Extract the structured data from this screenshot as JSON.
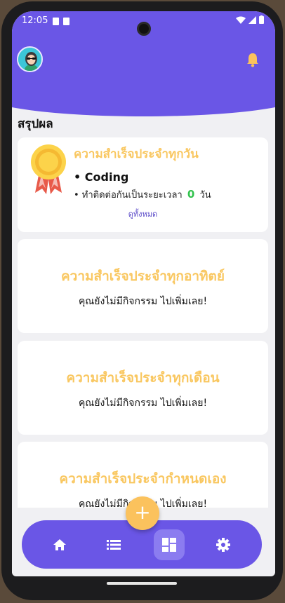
{
  "status_bar": {
    "time": "12:05"
  },
  "header": {
    "avatar": "user-avatar",
    "bell_icon": "bell-icon"
  },
  "section_title": "สรุปผล",
  "daily_card": {
    "title": "ความสำเร็จประจำทุกวัน",
    "habit": "• Coding",
    "streak_prefix": "• ทำติดต่อกันเป็นระยะเวลา",
    "streak_count": "0",
    "streak_unit": "วัน",
    "view_all": "ดูทั้งหมด"
  },
  "cards": [
    {
      "title": "ความสำเร็จประจำทุกอาทิตย์",
      "subtitle": "คุณยังไม่มีกิจกรรม ไปเพิ่มเลย!"
    },
    {
      "title": "ความสำเร็จประจำทุกเดือน",
      "subtitle": "คุณยังไม่มีกิจกรรม ไปเพิ่มเลย!"
    },
    {
      "title": "ความสำเร็จประจำกำหนดเอง",
      "subtitle": "คุณยังไม่มีกิจกรรม ไปเพิ่มเลย!"
    }
  ],
  "fab": {
    "label": "+"
  },
  "nav": [
    {
      "icon": "home-icon",
      "active": false
    },
    {
      "icon": "list-icon",
      "active": false
    },
    {
      "icon": "dashboard-icon",
      "active": true
    },
    {
      "icon": "settings-icon",
      "active": false
    }
  ],
  "colors": {
    "primary": "#6a56e6",
    "accent": "#f9c760",
    "success": "#32c24d"
  }
}
